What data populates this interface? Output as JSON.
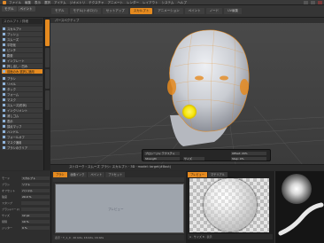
{
  "titlebar": {
    "menus": [
      "ファイル",
      "編集",
      "表示",
      "選択",
      "アイテム",
      "ジオメトリ",
      "テクスチャ",
      "アニメート",
      "レンダー",
      "レイアウト",
      "システム",
      "ヘルプ"
    ]
  },
  "layout_tabs": [
    "モデル",
    "ペイント",
    "スカルプト"
  ],
  "mode_tabs": [
    {
      "label": "モデル",
      "active": false
    },
    {
      "label": "モデル(トポロジ)",
      "active": false
    },
    {
      "label": "セットアップ",
      "active": false
    },
    {
      "label": "スカルプト",
      "active": true
    },
    {
      "label": "アニメーション",
      "active": false
    },
    {
      "label": "ペイント",
      "active": false
    },
    {
      "label": "ノード",
      "active": false
    },
    {
      "label": "UV編集",
      "active": false
    },
    {
      "label": "シェーディング",
      "active": false
    }
  ],
  "left_panel": {
    "header": "スカルプト / 詳細",
    "tools": [
      {
        "label": "スカルプト",
        "highlight": false
      },
      {
        "label": "プッシュ",
        "highlight": false
      },
      {
        "label": "スムーズ",
        "highlight": false
      },
      {
        "label": "平坦化",
        "highlight": false
      },
      {
        "label": "ピンチ",
        "highlight": false
      },
      {
        "label": "膨張",
        "highlight": false
      },
      {
        "label": "インフレート",
        "highlight": false
      },
      {
        "label": "押し出し・凹み",
        "highlight": false
      },
      {
        "label": "前面のみ 選択に適用",
        "highlight": true
      },
      {
        "label": "ブラシ",
        "highlight": false
      },
      {
        "label": "リペル",
        "highlight": false
      },
      {
        "label": "タック",
        "highlight": false
      },
      {
        "label": "フォーム",
        "highlight": false
      },
      {
        "label": "マスク",
        "highlight": false
      },
      {
        "label": "スムーズ(形状)",
        "highlight": false
      },
      {
        "label": "インクリメント",
        "highlight": false
      },
      {
        "label": "消しゴム",
        "highlight": false
      },
      {
        "label": "表示",
        "highlight": false
      },
      {
        "label": "頂点マップ",
        "highlight": false
      },
      {
        "label": "ハンドル",
        "highlight": false
      },
      {
        "label": "フォールオフ",
        "highlight": false
      },
      {
        "label": "マスク適用",
        "highlight": false
      },
      {
        "label": "ブラシのクリア",
        "highlight": false
      }
    ]
  },
  "viewport": {
    "label": "パースペクティブ",
    "footer": "ストローク・スムーズ ブラシ: スカルプト · 3D · model: target(#8out)"
  },
  "falloff": {
    "fields": [
      "プロシージャ テクスチャ",
      "Offset: 20%",
      "Strength",
      "Step: 0%",
      "サイズ"
    ]
  },
  "properties": {
    "title": "ブラシ",
    "rows": [
      {
        "label": "モード",
        "value": "スカルプト"
      },
      {
        "label": "ブラシ",
        "value": "ソフト"
      },
      {
        "label": "オフセット",
        "value": "ハンドル"
      },
      {
        "label": "強度",
        "value": "20.0 %"
      },
      {
        "label": "スタンプ",
        "value": ""
      },
      {
        "label": "ブラシ(ハード)",
        "value": ""
      },
      {
        "label": "サイズ",
        "value": "12 px"
      },
      {
        "label": "間隔",
        "value": "10 %"
      },
      {
        "label": "ジッター",
        "value": "0 %"
      }
    ]
  },
  "brush_panel": {
    "tabs": [
      {
        "label": "ブラシ",
        "active": true
      },
      {
        "label": "画像インク",
        "active": false
      },
      {
        "label": "ペイント",
        "active": false
      },
      {
        "label": "プリセット",
        "active": false
      }
    ],
    "preview_label": "プレビュー",
    "footer": "表示・T_1_0 · 20 bits, 16 bits, 16 bits"
  },
  "material_panel": {
    "tabs": [
      "プレビュー",
      "マテリアル"
    ],
    "footer": "A · サイズ 8 · 表示"
  },
  "colors": {
    "accent": "#e58a1f",
    "viewport_bg": "#404040",
    "brush_dot": "#f5e60a"
  },
  "icons": [
    "app-icon",
    "tool-icon",
    "minimize-icon",
    "maximize-icon",
    "close-icon"
  ]
}
